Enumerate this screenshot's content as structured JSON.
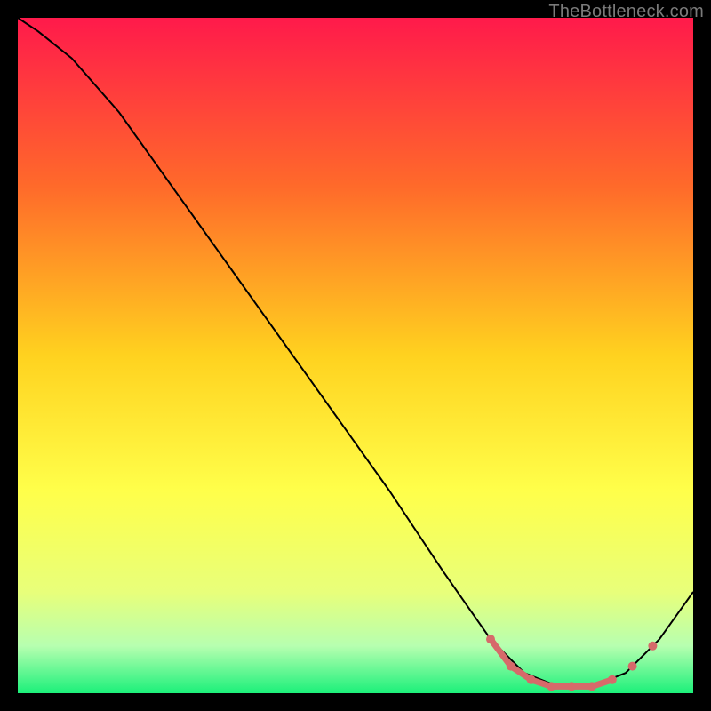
{
  "watermark": "TheBottleneck.com",
  "chart_data": {
    "type": "line",
    "title": "",
    "xlabel": "",
    "ylabel": "",
    "xlim": [
      0,
      100
    ],
    "ylim": [
      0,
      100
    ],
    "background_gradient": {
      "stops": [
        {
          "offset": 0,
          "color": "#ff1a4b"
        },
        {
          "offset": 25,
          "color": "#ff6a2a"
        },
        {
          "offset": 50,
          "color": "#ffd21f"
        },
        {
          "offset": 70,
          "color": "#ffff4a"
        },
        {
          "offset": 85,
          "color": "#e8ff7a"
        },
        {
          "offset": 93,
          "color": "#b7ffb0"
        },
        {
          "offset": 100,
          "color": "#1cf07a"
        }
      ]
    },
    "series": [
      {
        "name": "bottleneck-curve",
        "color": "#000000",
        "stroke_width": 2,
        "x": [
          0,
          3,
          8,
          15,
          25,
          35,
          45,
          55,
          63,
          70,
          75,
          80,
          85,
          90,
          95,
          100
        ],
        "y": [
          100,
          98,
          94,
          86,
          72,
          58,
          44,
          30,
          18,
          8,
          3,
          1,
          1,
          3,
          8,
          15
        ]
      }
    ],
    "highlight_segment": {
      "name": "optimal-range",
      "color": "#d66a6a",
      "stroke_width": 7,
      "x": [
        70,
        73,
        76,
        79,
        82,
        85,
        88
      ],
      "y": [
        8,
        4,
        2,
        1,
        1,
        1,
        2
      ]
    },
    "highlight_points": {
      "name": "markers",
      "color": "#d66a6a",
      "radius": 5,
      "x": [
        70,
        73,
        76,
        79,
        82,
        85,
        88,
        91,
        94
      ],
      "y": [
        8,
        4,
        2,
        1,
        1,
        1,
        2,
        4,
        7
      ]
    }
  }
}
